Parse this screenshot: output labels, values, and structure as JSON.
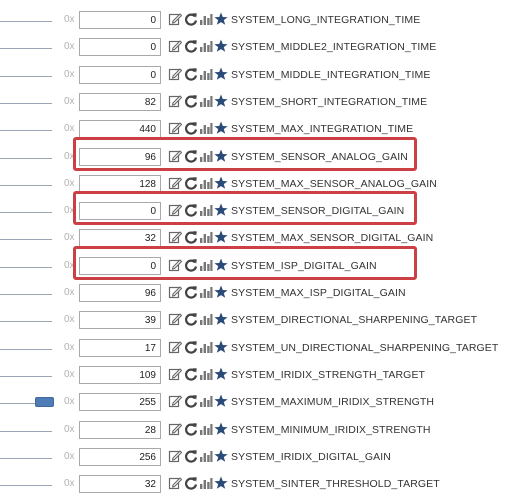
{
  "colors": {
    "highlight": "#cc3f45",
    "slider_thumb": "#4f7cb4",
    "star": "#2a4a78",
    "icon": "#555555"
  },
  "row_icons": [
    "edit-icon",
    "refresh-icon",
    "chart-icon",
    "star-icon"
  ],
  "hex_prefix": "0x",
  "rows": [
    {
      "value": "0",
      "name": "SYSTEM_LONG_INTEGRATION_TIME",
      "highlighted": false,
      "slider": false
    },
    {
      "value": "0",
      "name": "SYSTEM_MIDDLE2_INTEGRATION_TIME",
      "highlighted": false,
      "slider": false
    },
    {
      "value": "0",
      "name": "SYSTEM_MIDDLE_INTEGRATION_TIME",
      "highlighted": false,
      "slider": false
    },
    {
      "value": "82",
      "name": "SYSTEM_SHORT_INTEGRATION_TIME",
      "highlighted": false,
      "slider": false
    },
    {
      "value": "440",
      "name": "SYSTEM_MAX_INTEGRATION_TIME",
      "highlighted": false,
      "slider": false
    },
    {
      "value": "96",
      "name": "SYSTEM_SENSOR_ANALOG_GAIN",
      "highlighted": true,
      "slider": false
    },
    {
      "value": "128",
      "name": "SYSTEM_MAX_SENSOR_ANALOG_GAIN",
      "highlighted": false,
      "slider": false
    },
    {
      "value": "0",
      "name": "SYSTEM_SENSOR_DIGITAL_GAIN",
      "highlighted": true,
      "slider": false
    },
    {
      "value": "32",
      "name": "SYSTEM_MAX_SENSOR_DIGITAL_GAIN",
      "highlighted": false,
      "slider": false
    },
    {
      "value": "0",
      "name": "SYSTEM_ISP_DIGITAL_GAIN",
      "highlighted": true,
      "slider": false
    },
    {
      "value": "96",
      "name": "SYSTEM_MAX_ISP_DIGITAL_GAIN",
      "highlighted": false,
      "slider": false
    },
    {
      "value": "39",
      "name": "SYSTEM_DIRECTIONAL_SHARPENING_TARGET",
      "highlighted": false,
      "slider": false
    },
    {
      "value": "17",
      "name": "SYSTEM_UN_DIRECTIONAL_SHARPENING_TARGET",
      "highlighted": false,
      "slider": false
    },
    {
      "value": "109",
      "name": "SYSTEM_IRIDIX_STRENGTH_TARGET",
      "highlighted": false,
      "slider": false
    },
    {
      "value": "255",
      "name": "SYSTEM_MAXIMUM_IRIDIX_STRENGTH",
      "highlighted": false,
      "slider": true
    },
    {
      "value": "28",
      "name": "SYSTEM_MINIMUM_IRIDIX_STRENGTH",
      "highlighted": false,
      "slider": false
    },
    {
      "value": "256",
      "name": "SYSTEM_IRIDIX_DIGITAL_GAIN",
      "highlighted": false,
      "slider": false
    },
    {
      "value": "32",
      "name": "SYSTEM_SINTER_THRESHOLD_TARGET",
      "highlighted": false,
      "slider": false
    }
  ]
}
